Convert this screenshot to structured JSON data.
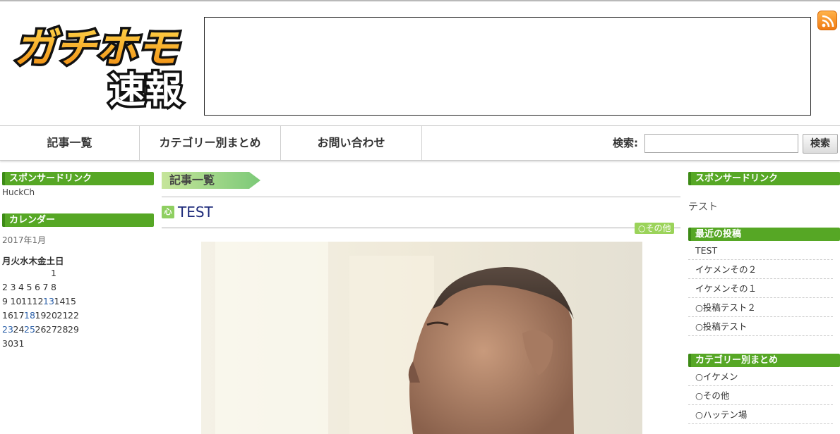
{
  "header": {
    "logo_line1": "ガチホモ",
    "logo_line2": "速報",
    "rss_icon": "rss-icon"
  },
  "nav": {
    "items": [
      "記事一覧",
      "カテゴリー別まとめ",
      "お問い合わせ"
    ],
    "search_label": "検索:",
    "search_value": "",
    "search_button": "検索"
  },
  "left_sidebar": {
    "sponsor_heading": "スポンサードリンク",
    "sponsor_text": "HuckCh",
    "calendar_heading": "カレンダー",
    "calendar_caption": "2017年1月",
    "weekdays": "月火水木金土日",
    "weeks": [
      [
        "",
        "",
        "",
        "",
        "",
        "",
        "1"
      ],
      [
        "2",
        "3",
        "4",
        "5",
        "6",
        "7",
        "8"
      ],
      [
        "9",
        "10",
        "11",
        "12",
        "13",
        "14",
        "15"
      ],
      [
        "16",
        "17",
        "18",
        "19",
        "20",
        "21",
        "22"
      ],
      [
        "23",
        "24",
        "25",
        "26",
        "27",
        "28",
        "29"
      ],
      [
        "30",
        "31"
      ]
    ],
    "linked_days": [
      "13",
      "18",
      "23",
      "25"
    ]
  },
  "main": {
    "section_title": "記事一覧",
    "post_icon_text": "心",
    "post_title": "TEST",
    "category_tag": "○その他"
  },
  "right_sidebar": {
    "sponsor_heading": "スポンサードリンク",
    "sponsor_text": "テスト",
    "recent_heading": "最近の投稿",
    "recent_posts": [
      "TEST",
      "イケメンその２",
      "イケメンその１",
      "○投稿テスト２",
      "○投稿テスト"
    ],
    "category_heading": "カテゴリー別まとめ",
    "categories": [
      "○イケメン",
      "○その他",
      "○ハッテン場"
    ]
  },
  "colors": {
    "accent_green": "#56a725",
    "title_blue": "#1d2a7a",
    "tag_green": "#9bd35a"
  }
}
